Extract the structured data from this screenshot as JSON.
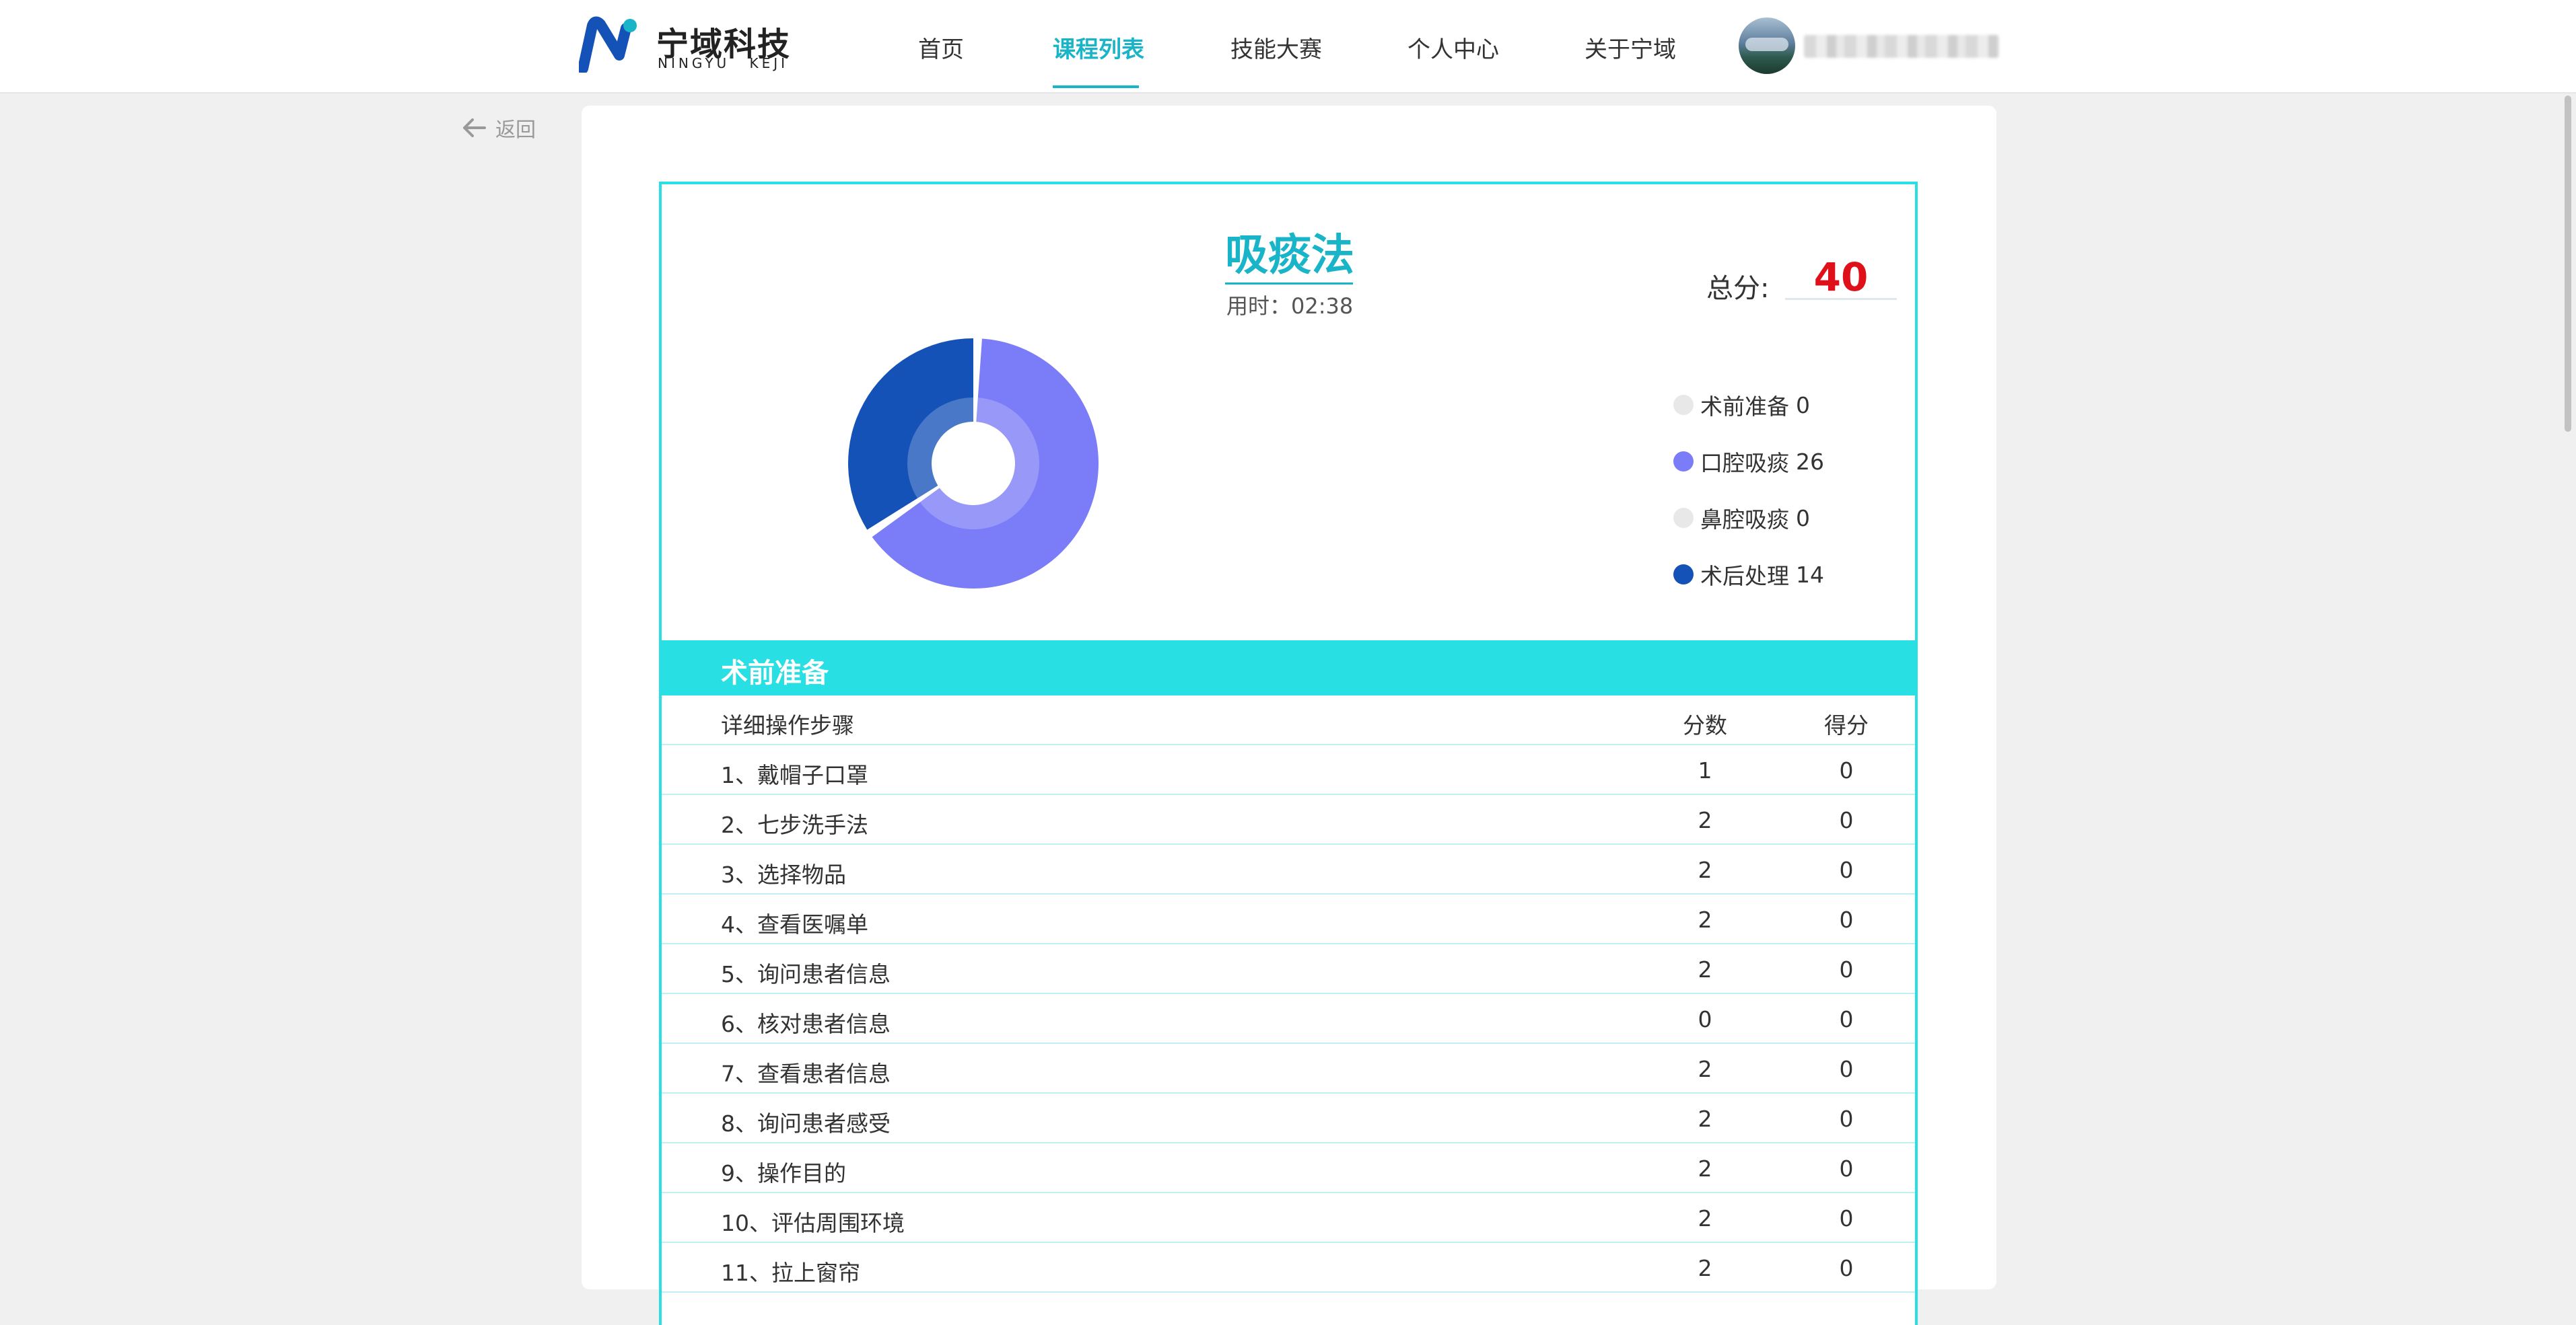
{
  "brand": {
    "name_cn": "宁域科技",
    "name_en": "NINGYU KEJI"
  },
  "nav": {
    "items": [
      "首页",
      "课程列表",
      "技能大赛",
      "个人中心",
      "关于宁域"
    ],
    "active": "课程列表"
  },
  "back_label": "返回",
  "report": {
    "title": "吸痰法",
    "time_label": "用时：",
    "time_value": "02:38",
    "total_label": "总分:",
    "total_value": "40"
  },
  "chart_data": {
    "type": "pie",
    "subtype": "donut",
    "categories": [
      "术前准备",
      "口腔吸痰",
      "鼻腔吸痰",
      "术后处理"
    ],
    "values": [
      0,
      26,
      0,
      14
    ],
    "colors": [
      "#e8e8e8",
      "#7b7cf8",
      "#e8e8e8",
      "#1552b8"
    ],
    "legend_placement": "right"
  },
  "legend": [
    {
      "label": "术前准备",
      "value": "0",
      "color": "#e8e8e8"
    },
    {
      "label": "口腔吸痰",
      "value": "26",
      "color": "#7b7cf8"
    },
    {
      "label": "鼻腔吸痰",
      "value": "0",
      "color": "#e8e8e8"
    },
    {
      "label": "术后处理",
      "value": "14",
      "color": "#1552b8"
    }
  ],
  "section": {
    "title": "术前准备",
    "headers": {
      "step": "详细操作步骤",
      "score": "分数",
      "got": "得分"
    },
    "rows": [
      {
        "step": "1、戴帽子口罩",
        "score": "1",
        "got": "0"
      },
      {
        "step": "2、七步洗手法",
        "score": "2",
        "got": "0"
      },
      {
        "step": "3、选择物品",
        "score": "2",
        "got": "0"
      },
      {
        "step": "4、查看医嘱单",
        "score": "2",
        "got": "0"
      },
      {
        "step": "5、询问患者信息",
        "score": "2",
        "got": "0"
      },
      {
        "step": "6、核对患者信息",
        "score": "0",
        "got": "0"
      },
      {
        "step": "7、查看患者信息",
        "score": "2",
        "got": "0"
      },
      {
        "step": "8、询问患者感受",
        "score": "2",
        "got": "0"
      },
      {
        "step": "9、操作目的",
        "score": "2",
        "got": "0"
      },
      {
        "step": "10、评估周围环境",
        "score": "2",
        "got": "0"
      },
      {
        "step": "11、拉上窗帘",
        "score": "2",
        "got": "0"
      }
    ]
  },
  "colors": {
    "accent": "#1ab4c9",
    "table_bar": "#28dfe3",
    "total": "#e0101a"
  }
}
